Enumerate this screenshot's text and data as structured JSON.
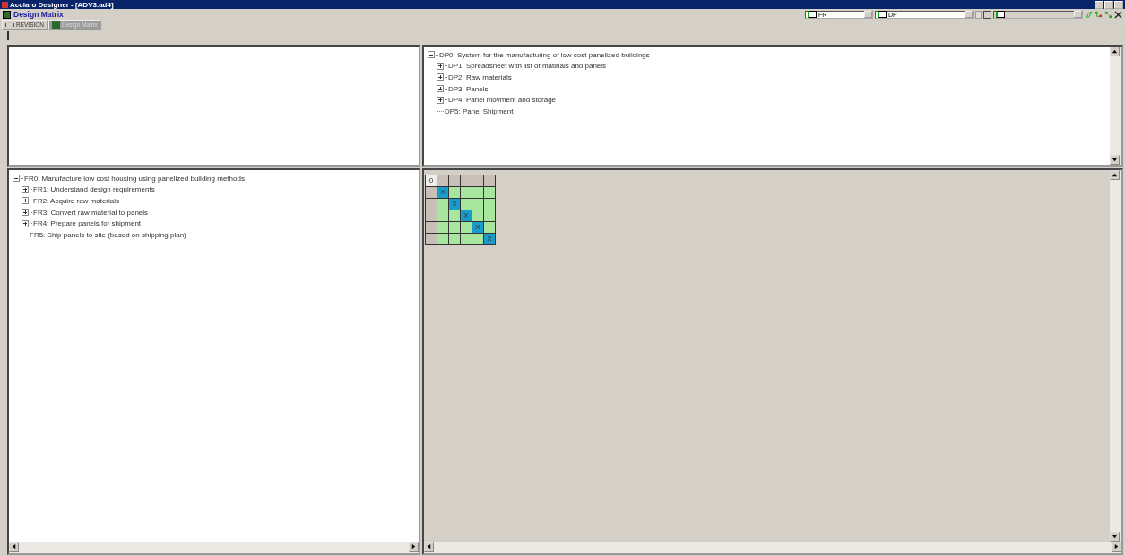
{
  "window": {
    "title": "Acclaro Designer - [ADV3.ad4]"
  },
  "document": {
    "title": "Design Matrix"
  },
  "toolbar": {
    "combos": [
      {
        "value": "FR",
        "disabled": false
      },
      {
        "value": "DP",
        "disabled": false
      },
      {
        "disabled": true
      }
    ]
  },
  "tabs": [
    {
      "label": "REVISION",
      "selected": false
    },
    {
      "label": "Design Matrix",
      "selected": true
    }
  ],
  "dp_tree": {
    "label": "DP0: System for the manufacturing of low cost panelized buildings",
    "expanded": true,
    "children": [
      {
        "label": "DP1:  Spreadsheet with list of matirials and panels",
        "expanded": false
      },
      {
        "label": "DP2: Raw materials",
        "expanded": false
      },
      {
        "label": "DP3: Panels",
        "expanded": false
      },
      {
        "label": "DP4: Panel movment and storage",
        "expanded": false
      },
      {
        "label": "DP5: Panel Shipment"
      }
    ]
  },
  "fr_tree": {
    "label": "FR0:  Manufacture low cost housing using panelized building methods",
    "expanded": true,
    "children": [
      {
        "label": "FR1: Understand design requirements",
        "expanded": false
      },
      {
        "label": "FR2: Acquire raw materials",
        "expanded": false
      },
      {
        "label": "FR3: Convert raw material to panels",
        "expanded": false
      },
      {
        "label": "FR4: Prepare panels for shipment",
        "expanded": false
      },
      {
        "label": "FR5: Ship panels to site (based on shipping plan)"
      }
    ]
  },
  "matrix": {
    "corner": "0",
    "rows": [
      [
        "X",
        "",
        "",
        "",
        ""
      ],
      [
        "",
        "X",
        "",
        "",
        ""
      ],
      [
        "",
        "",
        "X",
        "",
        ""
      ],
      [
        "",
        "",
        "",
        "X",
        ""
      ],
      [
        "",
        "",
        "",
        "",
        "X"
      ]
    ]
  }
}
